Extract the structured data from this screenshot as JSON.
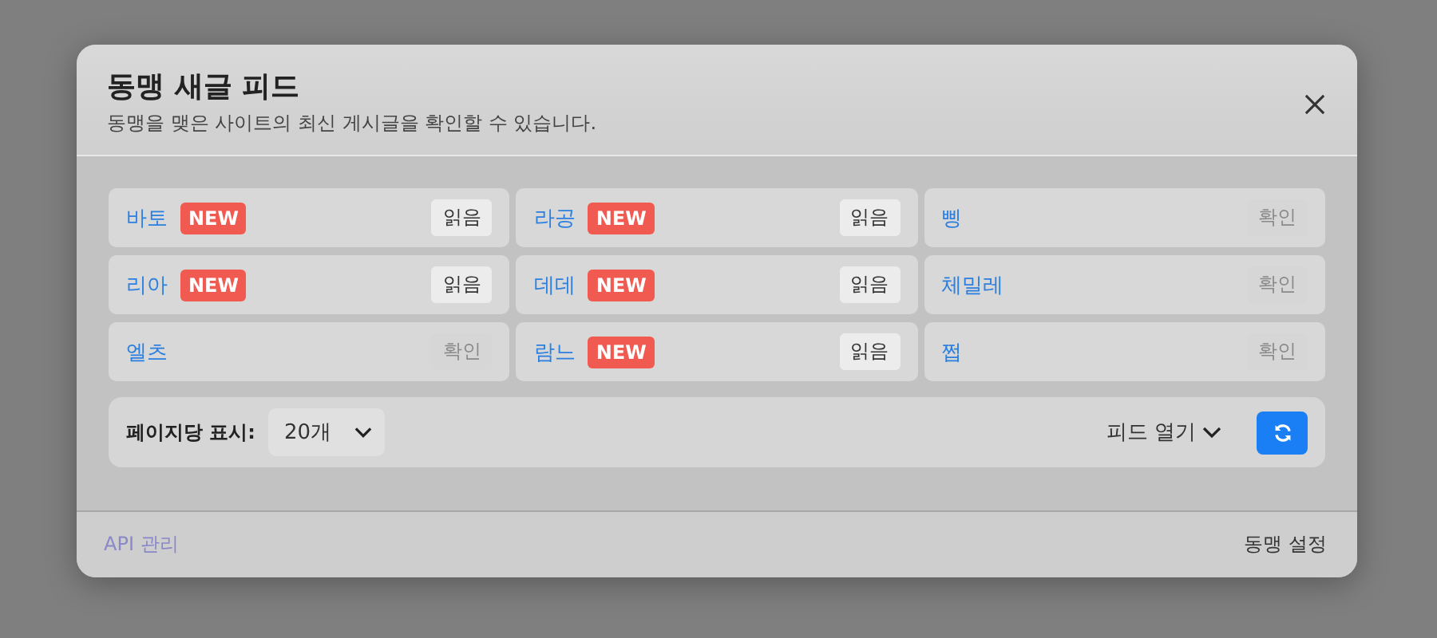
{
  "dialog": {
    "title": "동맹 새글 피드",
    "subtitle": "동맹을 맺은 사이트의 최신 게시글을 확인할 수 있습니다."
  },
  "feeds": [
    {
      "name": "바토",
      "new": true,
      "badge": "NEW",
      "action": "읽음",
      "disabled": false
    },
    {
      "name": "라공",
      "new": true,
      "badge": "NEW",
      "action": "읽음",
      "disabled": false
    },
    {
      "name": "삥",
      "new": false,
      "action": "확인",
      "disabled": true
    },
    {
      "name": "리아",
      "new": true,
      "badge": "NEW",
      "action": "읽음",
      "disabled": false
    },
    {
      "name": "데데",
      "new": true,
      "badge": "NEW",
      "action": "읽음",
      "disabled": false
    },
    {
      "name": "체밀레",
      "new": false,
      "action": "확인",
      "disabled": true
    },
    {
      "name": "엘츠",
      "new": false,
      "action": "확인",
      "disabled": true
    },
    {
      "name": "람느",
      "new": true,
      "badge": "NEW",
      "action": "읽음",
      "disabled": false
    },
    {
      "name": "쩝",
      "new": false,
      "action": "확인",
      "disabled": true
    }
  ],
  "toolbar": {
    "per_page_label": "페이지당 표시:",
    "per_page_value": "20개",
    "open_feed": "피드 열기"
  },
  "footer": {
    "api_link": "API 관리",
    "settings_link": "동맹 설정"
  }
}
